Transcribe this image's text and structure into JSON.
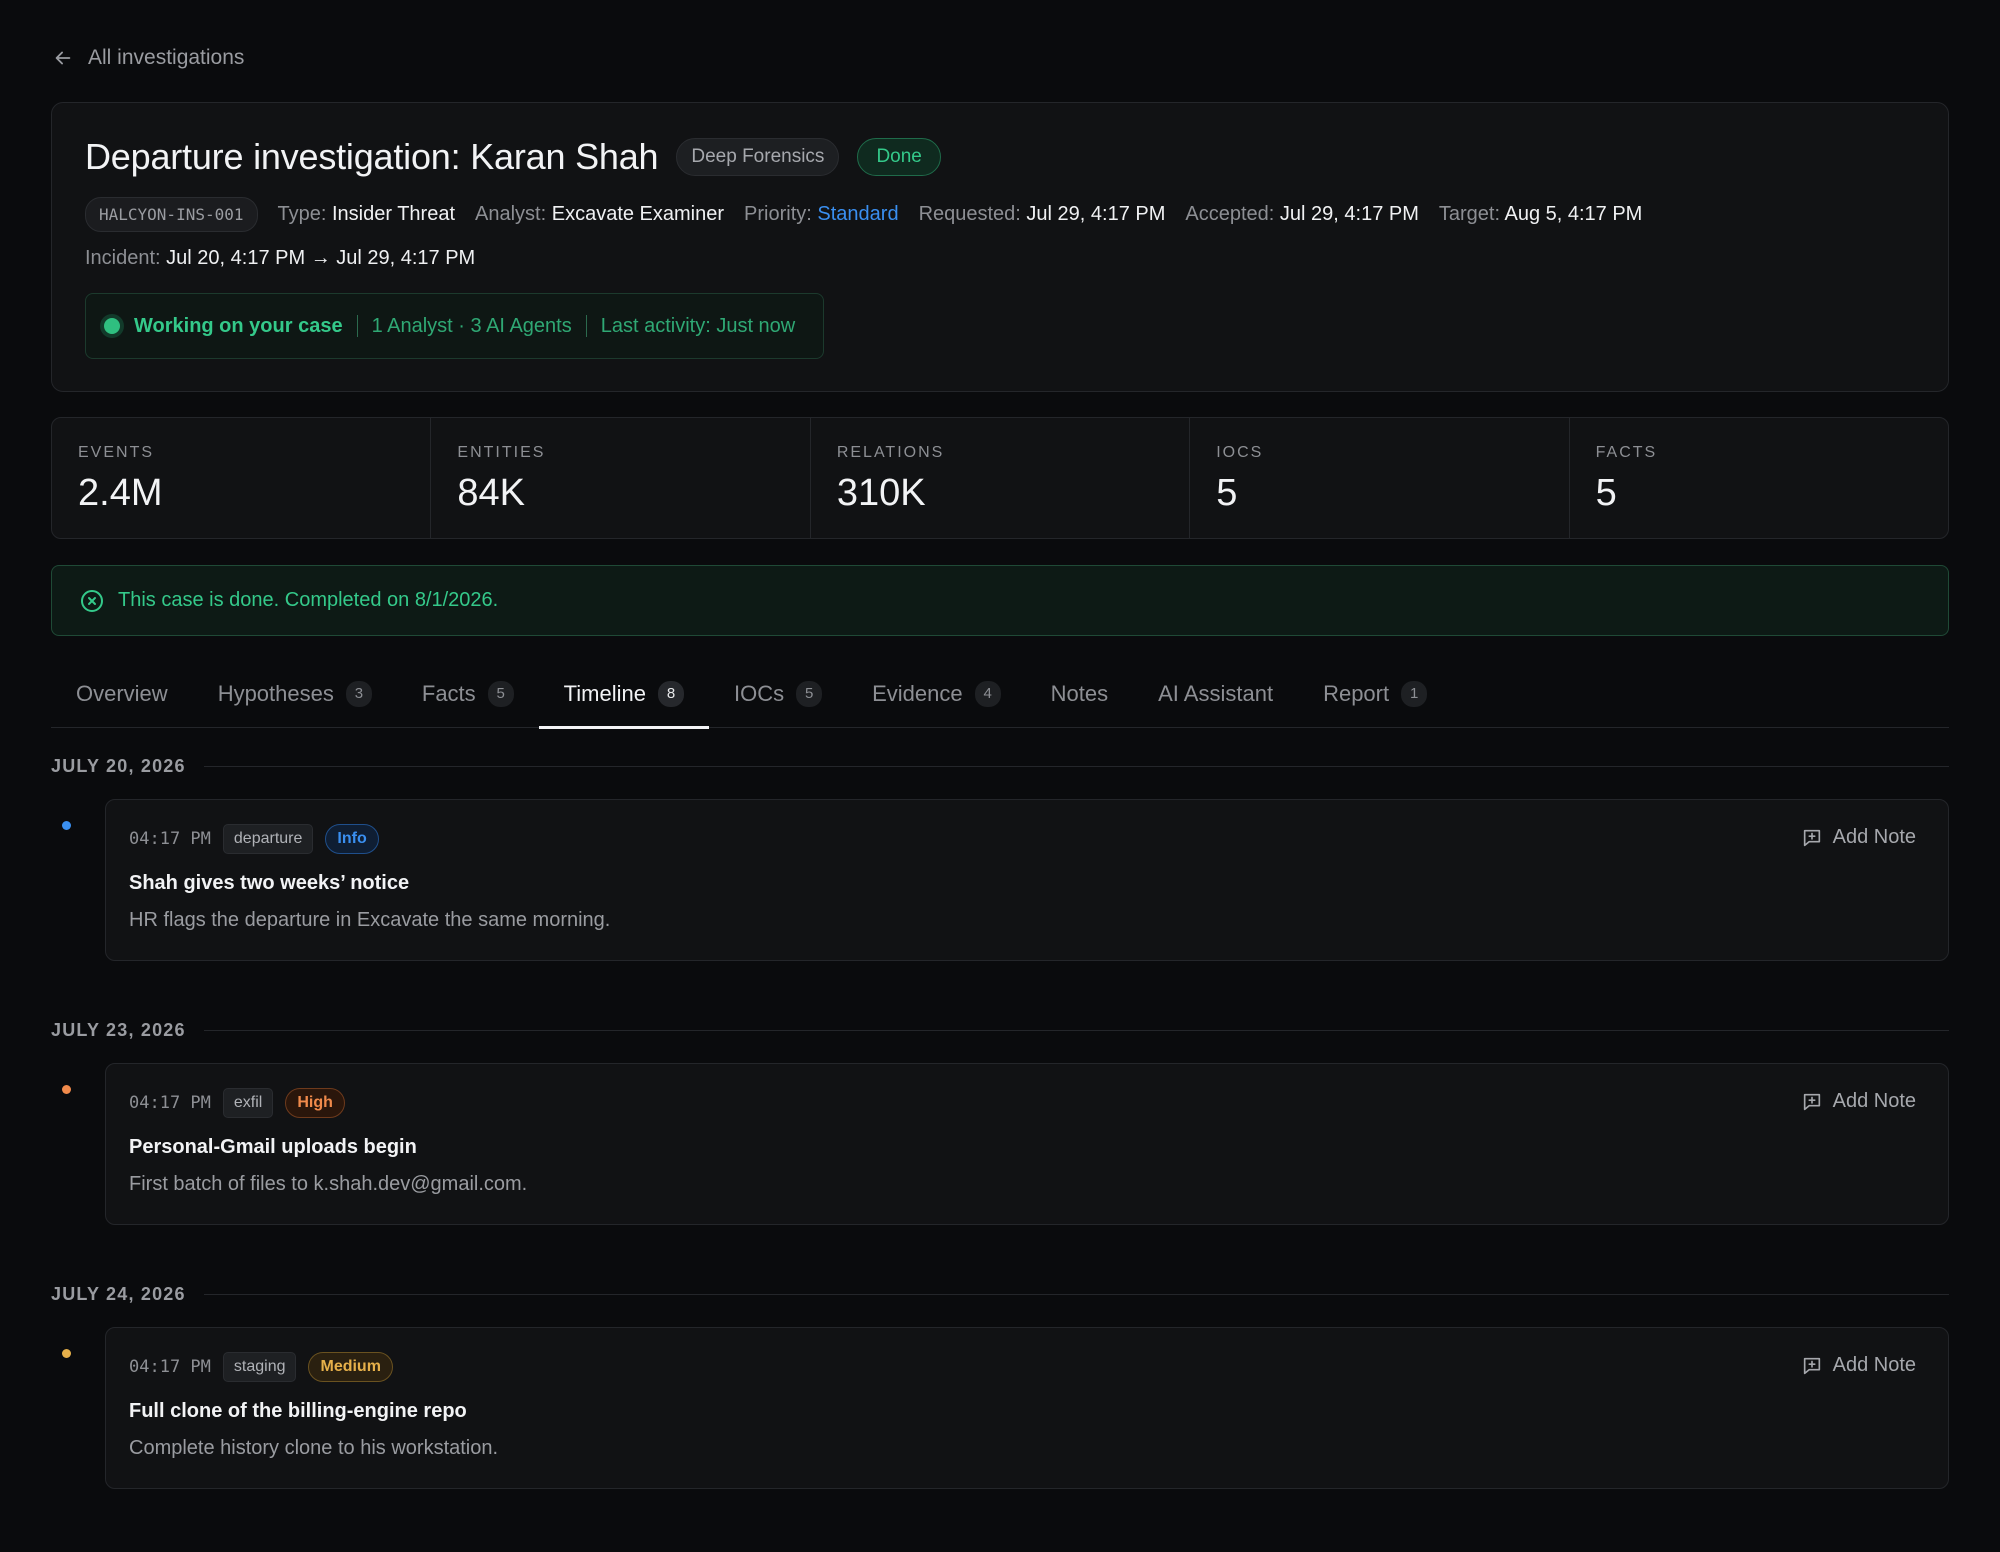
{
  "nav": {
    "back_label": "All investigations"
  },
  "header": {
    "title": "Departure investigation: Karan Shah",
    "tier_tag": "Deep Forensics",
    "status": "Done",
    "case_id": "HALCYON-INS-001",
    "meta": [
      {
        "key": "Type:",
        "value": "Insider Threat"
      },
      {
        "key": "Analyst:",
        "value": "Excavate Examiner"
      },
      {
        "key": "Priority:",
        "value": "Standard"
      },
      {
        "key": "Requested:",
        "value": "Jul 29, 4:17 PM"
      },
      {
        "key": "Accepted:",
        "value": "Jul 29, 4:17 PM"
      },
      {
        "key": "Target:",
        "value": "Aug 5, 4:17 PM"
      }
    ],
    "incident_key": "Incident:",
    "incident_value": "Jul 20, 4:17 PM → Jul 29, 4:17 PM",
    "working": {
      "main": "Working on your case",
      "team": "1 Analyst · 3 AI Agents",
      "activity": "Last activity: Just now"
    }
  },
  "stats": [
    {
      "label": "EVENTS",
      "value": "2.4M"
    },
    {
      "label": "ENTITIES",
      "value": "84K"
    },
    {
      "label": "RELATIONS",
      "value": "310K"
    },
    {
      "label": "IOCS",
      "value": "5"
    },
    {
      "label": "FACTS",
      "value": "5"
    }
  ],
  "banner": {
    "text": "This case is done. Completed on 8/1/2026."
  },
  "tabs": [
    {
      "label": "Overview",
      "count": ""
    },
    {
      "label": "Hypotheses",
      "count": "3"
    },
    {
      "label": "Facts",
      "count": "5"
    },
    {
      "label": "Timeline",
      "count": "8",
      "active": true
    },
    {
      "label": "IOCs",
      "count": "5"
    },
    {
      "label": "Evidence",
      "count": "4"
    },
    {
      "label": "Notes",
      "count": ""
    },
    {
      "label": "AI Assistant",
      "count": ""
    },
    {
      "label": "Report",
      "count": "1"
    }
  ],
  "timeline": [
    {
      "date": "JULY 20, 2026",
      "time": "04:17 PM",
      "category": "departure",
      "severity": "Info",
      "severity_color": "#3a8ff0",
      "title": "Shah gives two weeks’ notice",
      "description": "HR flags the departure in Excavate the same morning.",
      "action": "Add Note"
    },
    {
      "date": "JULY 23, 2026",
      "time": "04:17 PM",
      "category": "exfil",
      "severity": "High",
      "severity_color": "#f08a4b",
      "title": "Personal-Gmail uploads begin",
      "description": "First batch of files to k.shah.dev@gmail.com.",
      "action": "Add Note"
    },
    {
      "date": "JULY 24, 2026",
      "time": "04:17 PM",
      "category": "staging",
      "severity": "Medium",
      "severity_color": "#e6b04a",
      "title": "Full clone of the billing-engine repo",
      "description": "Complete history clone to his workstation.",
      "action": "Add Note"
    }
  ]
}
